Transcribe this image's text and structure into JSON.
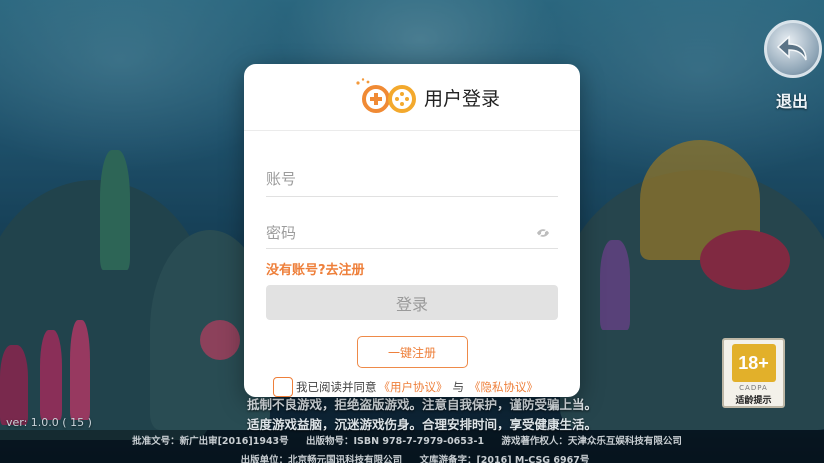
{
  "dialog": {
    "title": "用户登录",
    "username_placeholder": "账号",
    "password_placeholder": "密码",
    "register_link": "没有账号?去注册",
    "login_button": "登录",
    "onekey_button": "一键注册",
    "agree_prefix": "我已阅读并同意",
    "user_agreement": "《用户协议》",
    "agree_and": "与",
    "privacy_agreement": "《隐私协议》"
  },
  "back": {
    "label": "退出"
  },
  "age_rating": {
    "age": "18+",
    "org": "CADPA",
    "hint": "适龄提示"
  },
  "version": "ver: 1.0.0 ( 15 )",
  "health_tip": {
    "line1": "抵制不良游戏，拒绝盗版游戏。注意自我保护，谨防受骗上当。",
    "line2": "适度游戏益脑，沉迷游戏伤身。合理安排时间，享受健康生活。"
  },
  "footer": {
    "approval": "批准文号：新广出审[2016]1943号",
    "pub_no": "出版物号：ISBN 978-7-7979-0653-1",
    "copyright": "游戏著作权人：天津众乐互娱科技有限公司",
    "publisher": "出版单位：北京畅元国讯科技有限公司",
    "record": "文库游备字：[2016] M-CSG 6967号"
  },
  "colors": {
    "accent": "#ee7f3a",
    "button_disabled": "#e2e2e2",
    "background": "#2a6f93"
  }
}
